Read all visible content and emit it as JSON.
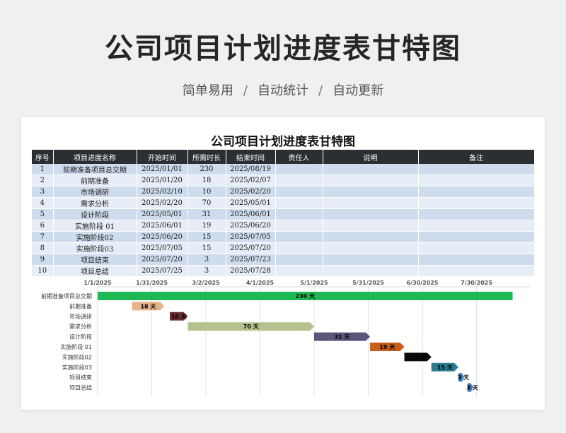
{
  "header": {
    "title": "公司项目计划进度表甘特图",
    "tags": [
      "简单易用",
      "自动统计",
      "自动更新"
    ],
    "separator": "/"
  },
  "sheet": {
    "title": "公司项目计划进度表甘特图",
    "columns": [
      "序号",
      "项目进度名称",
      "开始时间",
      "所需时长",
      "结束时间",
      "责任人",
      "说明",
      "备注"
    ],
    "rows": [
      [
        "1",
        "前期准备项目总交期",
        "2025/01/01",
        "230",
        "2025/08/19",
        "",
        "",
        ""
      ],
      [
        "2",
        "前期准备",
        "2025/01/20",
        "18",
        "2025/02/07",
        "",
        "",
        ""
      ],
      [
        "3",
        "市场调研",
        "2025/02/10",
        "10",
        "2025/02/20",
        "",
        "",
        ""
      ],
      [
        "4",
        "需求分析",
        "2025/02/20",
        "70",
        "2025/05/01",
        "",
        "",
        ""
      ],
      [
        "5",
        "设计阶段",
        "2025/05/01",
        "31",
        "2025/06/01",
        "",
        "",
        ""
      ],
      [
        "6",
        "实施阶段 01",
        "2025/06/01",
        "19",
        "2025/06/20",
        "",
        "",
        ""
      ],
      [
        "7",
        "实施阶段02",
        "2025/06/20",
        "15",
        "2025/07/05",
        "",
        "",
        ""
      ],
      [
        "8",
        "实施阶段03",
        "2025/07/05",
        "15",
        "2025/07/20",
        "",
        "",
        ""
      ],
      [
        "9",
        "项目结束",
        "2025/07/20",
        "3",
        "2025/07/23",
        "",
        "",
        ""
      ],
      [
        "10",
        "项目总结",
        "2025/07/25",
        "3",
        "2025/07/28",
        "",
        "",
        ""
      ]
    ]
  },
  "chart_data": {
    "type": "bar",
    "orientation": "horizontal-gantt",
    "x_ticks": [
      "1/1/2025",
      "1/31/2025",
      "3/2/2025",
      "4/1/2025",
      "5/1/2025",
      "5/31/2025",
      "6/30/2025",
      "7/30/2025"
    ],
    "xlim": [
      "2025-01-01",
      "2025-08-29"
    ],
    "unit": "天",
    "tasks": [
      {
        "name": "前期准备项目总交期",
        "start": "2025-01-01",
        "duration": 230,
        "color": "#1db954"
      },
      {
        "name": "前期准备",
        "start": "2025-01-20",
        "duration": 18,
        "color": "#e6b48a"
      },
      {
        "name": "市场调研",
        "start": "2025-02-10",
        "duration": 10,
        "color": "#6b2e30"
      },
      {
        "name": "需求分析",
        "start": "2025-02-20",
        "duration": 70,
        "color": "#b4c38e"
      },
      {
        "name": "设计阶段",
        "start": "2025-05-01",
        "duration": 31,
        "color": "#5e557a"
      },
      {
        "name": "实施阶段 01",
        "start": "2025-06-01",
        "duration": 19,
        "color": "#c65f19"
      },
      {
        "name": "实施阶段02",
        "start": "2025-06-20",
        "duration": 15,
        "color": "#0b0b0b"
      },
      {
        "name": "实施阶段03",
        "start": "2025-07-05",
        "duration": 15,
        "color": "#2a7d8e"
      },
      {
        "name": "项目结束",
        "start": "2025-07-20",
        "duration": 3,
        "color": "#3d7ab8"
      },
      {
        "name": "项目总结",
        "start": "2025-07-25",
        "duration": 3,
        "color": "#3d7ab8"
      }
    ]
  }
}
